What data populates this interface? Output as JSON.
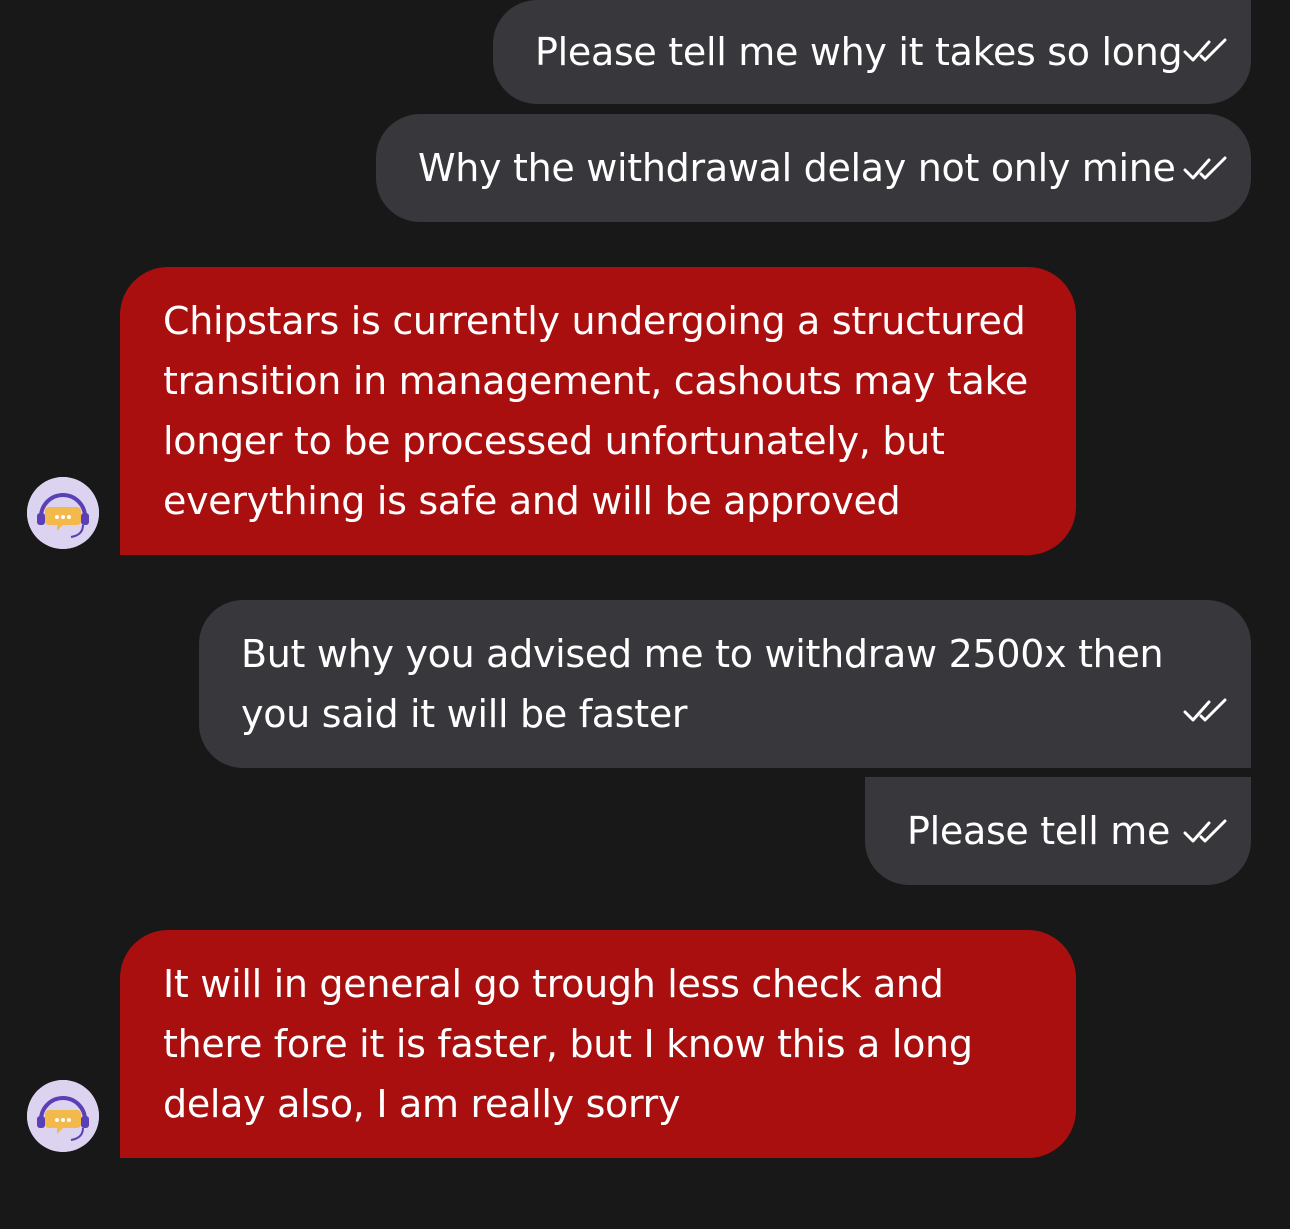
{
  "messages": [
    {
      "sender": "user",
      "text": "Please tell me why it takes so long",
      "status_icon": "double-check-icon"
    },
    {
      "sender": "user",
      "text": "Why the withdrawal delay not only mine",
      "status_icon": "double-check-icon"
    },
    {
      "sender": "agent",
      "text": "Chipstars is currently undergoing a structured transition in management, cashouts may take longer to be processed unfortunately, but everything is safe and will be approved",
      "avatar_icon": "support-agent-avatar-icon"
    },
    {
      "sender": "user",
      "text": "But why you advised me to withdraw 2500x then you said it will be faster",
      "status_icon": "double-check-icon"
    },
    {
      "sender": "user",
      "text": "Please tell me",
      "status_icon": "double-check-icon"
    },
    {
      "sender": "agent",
      "text": "It will in general go trough less check and there fore it is faster, but I know this a long delay also, I am really sorry",
      "avatar_icon": "support-agent-avatar-icon"
    }
  ],
  "colors": {
    "background": "#181819",
    "user_bubble": "#38383c",
    "agent_bubble": "#a80f0e",
    "text": "#ffffff",
    "avatar_bg": "#dcd3f0"
  }
}
